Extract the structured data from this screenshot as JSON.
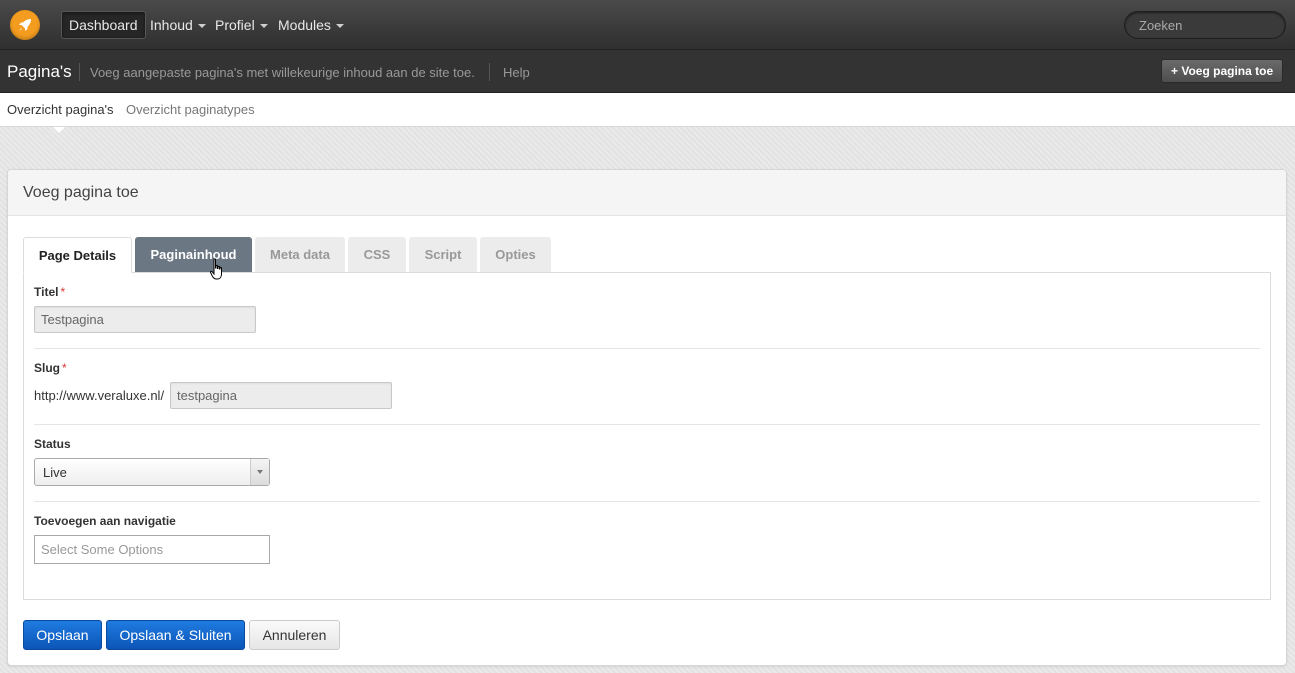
{
  "navbar": {
    "items": [
      "Dashboard",
      "Inhoud",
      "Profiel",
      "Modules"
    ],
    "search_placeholder": "Zoeken"
  },
  "subheader": {
    "title": "Pagina's",
    "description": "Voeg aangepaste pagina's met willekeurige inhoud aan de site toe.",
    "help": "Help",
    "add_button": "+ Voeg pagina toe"
  },
  "subnav": {
    "items": [
      "Overzicht pagina's",
      "Overzicht paginatypes"
    ]
  },
  "panel": {
    "title": "Voeg pagina toe",
    "tabs": [
      "Page Details",
      "Paginainhoud",
      "Meta data",
      "CSS",
      "Script",
      "Opties"
    ],
    "active_tab": "Page Details",
    "hovered_tab": "Paginainhoud"
  },
  "form": {
    "title_label": "Titel",
    "title_value": "Testpagina",
    "required_mark": "*",
    "slug_label": "Slug",
    "slug_prefix": "http://www.veraluxe.nl/",
    "slug_value": "testpagina",
    "status_label": "Status",
    "status_value": "Live",
    "nav_label": "Toevoegen aan navigatie",
    "nav_placeholder": "Select Some Options"
  },
  "buttons": {
    "save": "Opslaan",
    "save_close": "Opslaan & Sluiten",
    "cancel": "Annuleren"
  },
  "colors": {
    "logo": "#f39c1f",
    "primary_button": "#1a6fd3",
    "hover_tab": "#6b7783",
    "required": "#dd3333"
  }
}
